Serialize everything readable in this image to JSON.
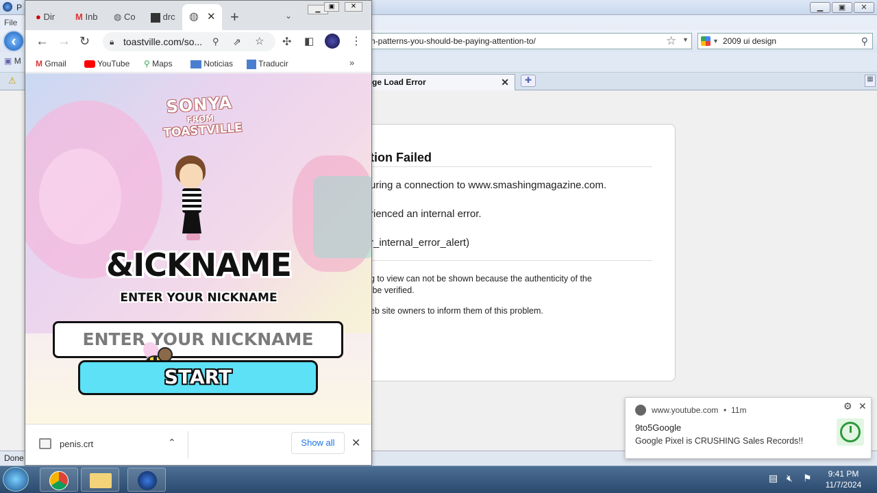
{
  "bg_window": {
    "title_fragment": "P",
    "menu_file": "File",
    "url_fragment": "n-patterns-you-should-be-paying-attention-to/",
    "search_value": "2009 ui design",
    "tab_label": "ge Load Error",
    "error": {
      "title": "tion Failed",
      "line1": "uring a connection to www.smashingmagazine.com.",
      "line2": "rienced an internal error.",
      "line3": "r_internal_error_alert)",
      "small1": "g to view can not be shown because the authenticity of the",
      "small2": " be verified.",
      "small3": "eb site owners to inform them of this problem."
    },
    "status": "Done",
    "left_fragment": "M"
  },
  "chrome": {
    "tabs": [
      {
        "label": "Dir",
        "icon": "red-bird-icon"
      },
      {
        "label": "Inb",
        "icon": "gmail-icon"
      },
      {
        "label": "Co",
        "icon": "globe-icon"
      },
      {
        "label": "drc",
        "icon": "terminal-icon"
      }
    ],
    "url": "toastville.com/so...",
    "bookmarks": [
      "Gmail",
      "YouTube",
      "Maps",
      "Noticias",
      "Traducir"
    ],
    "download_file": "penis.crt",
    "show_all": "Show all"
  },
  "page": {
    "logo_line1": "SONYA",
    "logo_line2": "FROM",
    "logo_line3": "TOASTVILLE",
    "heading": "ICKNAME",
    "heading_glyph": "&",
    "subheading": "ENTER YOUR NICKNAME",
    "input_placeholder": "ENTER YOUR NICKNAME",
    "start": "START"
  },
  "notification": {
    "source": "www.youtube.com",
    "age": "11m",
    "title": "9to5Google",
    "body": "Google Pixel is CRUSHING Sales Records!!"
  },
  "clock": {
    "time": "9:41 PM",
    "date": "11/7/2024"
  },
  "colors": {
    "start_button": "#5ce1f7",
    "chrome_tabbar": "#dee1e6",
    "taskbar": "#2a4a6e"
  }
}
